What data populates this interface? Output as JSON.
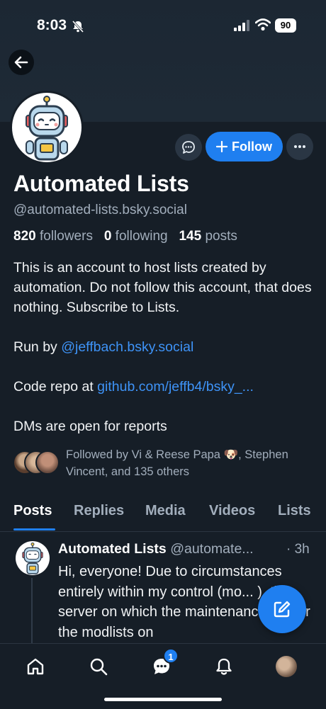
{
  "status": {
    "time": "8:03",
    "battery": "90"
  },
  "profile": {
    "name": "Automated Lists",
    "handle": "@automated-lists.bsky.social",
    "followers_count": "820",
    "followers_label": "followers",
    "following_count": "0",
    "following_label": "following",
    "posts_count": "145",
    "posts_label": "posts",
    "bio_line1": "This is an account to host lists created by automation. Do not follow this account, that does nothing. Subscribe to Lists.",
    "bio_run_prefix": "Run by ",
    "bio_run_link": "@jeffbach.bsky.social",
    "bio_code_prefix": "Code repo at ",
    "bio_code_link": "github.com/jeffb4/bsky_...",
    "bio_dms": "DMs are open for reports",
    "followed_by": "Followed by Vi & Reese Papa 🐶, Stephen Vincent, and 135 others"
  },
  "actions": {
    "follow_label": "Follow"
  },
  "tabs": [
    "Posts",
    "Replies",
    "Media",
    "Videos",
    "Lists"
  ],
  "active_tab": "Posts",
  "post": {
    "author": "Automated Lists",
    "handle": "@automate...",
    "time": "· 3h",
    "text": "Hi, everyone! Due to circumstances entirely within my control (mo... ), the server on which the maintenance bot for the modlists on"
  },
  "nav": {
    "chat_badge": "1"
  },
  "colors": {
    "accent": "#1f7ff0",
    "link": "#3e93f7",
    "background": "#161e27"
  },
  "icons": [
    "back-arrow-icon",
    "chat-bubble-icon",
    "plus-icon",
    "ellipsis-icon",
    "compose-icon",
    "home-icon",
    "search-icon",
    "chat-icon",
    "bell-icon"
  ]
}
